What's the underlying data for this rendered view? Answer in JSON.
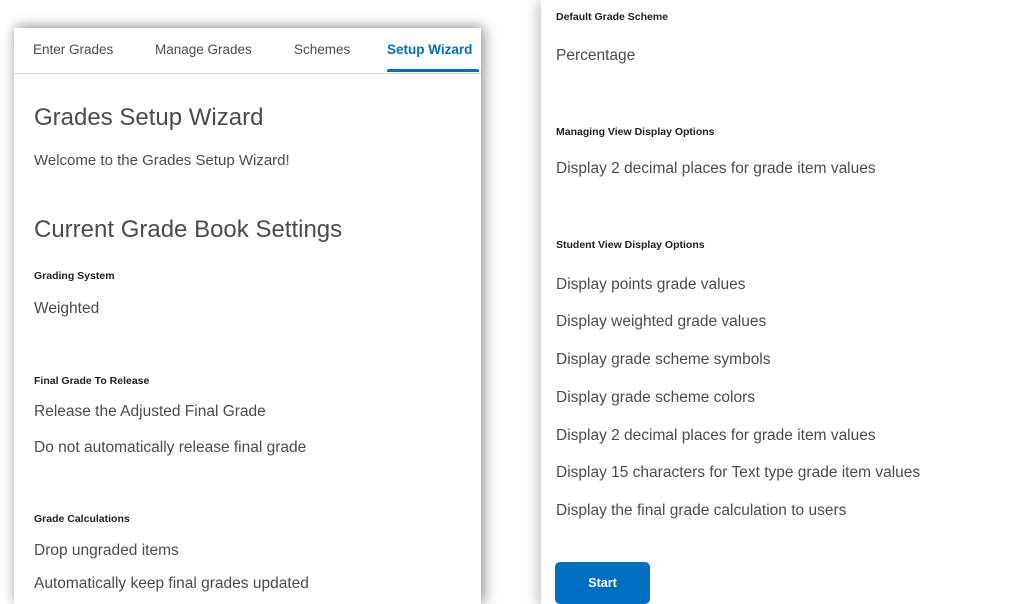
{
  "tabs": [
    {
      "label": "Enter Grades"
    },
    {
      "label": "Manage Grades"
    },
    {
      "label": "Schemes"
    },
    {
      "label": "Setup Wizard"
    }
  ],
  "page": {
    "title": "Grades Setup Wizard",
    "welcome": "Welcome to the Grades Setup Wizard!",
    "section_title": "Current Grade Book Settings"
  },
  "settings": {
    "grading_system": {
      "label": "Grading System",
      "value": "Weighted"
    },
    "final_grade": {
      "label": "Final Grade To Release",
      "values": [
        "Release the Adjusted Final Grade",
        "Do not automatically release final grade"
      ]
    },
    "grade_calculations": {
      "label": "Grade Calculations",
      "values": [
        "Drop ungraded items",
        "Automatically keep final grades updated"
      ]
    },
    "default_scheme": {
      "label": "Default Grade Scheme",
      "value": "Percentage"
    },
    "managing_view": {
      "label": "Managing View Display Options",
      "values": [
        "Display 2 decimal places for grade item values"
      ]
    },
    "student_view": {
      "label": "Student View Display Options",
      "values": [
        "Display points grade values",
        "Display weighted grade values",
        "Display grade scheme symbols",
        "Display grade scheme colors",
        "Display 2 decimal places for grade item values",
        "Display 15 characters for Text type grade item values",
        "Display the final grade calculation to users"
      ]
    }
  },
  "start_label": "Start",
  "colors": {
    "accent": "#006fbf",
    "text": "#494c4e"
  }
}
